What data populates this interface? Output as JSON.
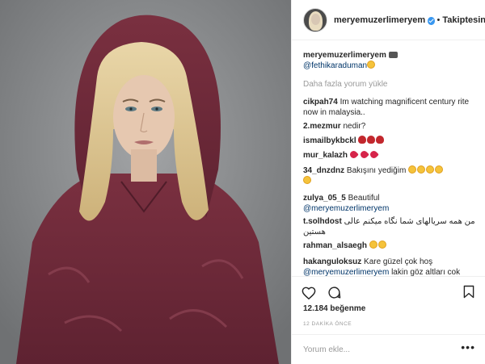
{
  "photo": {
    "alt_icon": "portrait-photo"
  },
  "header": {
    "username": "meryemuzerlimeryem",
    "separator": "•",
    "follow_state": "Takiptesin"
  },
  "caption": {
    "username": "meryemuzerlimeryem",
    "mention": "@fethikaraduman"
  },
  "load_more": "Daha fazla yorum yükle",
  "comments": [
    {
      "user": "cikpah74",
      "text": "Im watching magnificent century rite now in malaysia.."
    },
    {
      "user": "2.mezmur",
      "text": "nedir?"
    },
    {
      "user": "ismailbykbckl",
      "text": ""
    },
    {
      "user": "mur_kalazh",
      "text": ""
    },
    {
      "user": "34_dnzdnz",
      "text": "Bakışını yediğim"
    },
    {
      "user": "zulya_05_5",
      "text": "Beautiful",
      "mention": "@meryemuzerlimeryem"
    },
    {
      "user": "t.solhdost",
      "text": "من همه سریالهای شما نگاه میکنم عالی هستین"
    },
    {
      "user": "rahman_alsaegh",
      "text": ""
    },
    {
      "user": "hakanguloksuz",
      "text": "Kare güzel çok hoş",
      "mention": "@meryemuzerlimeryem",
      "text2": "lakin göz altları cok"
    }
  ],
  "likes": "12.184 beğenme",
  "time": "12 DAKİKA ÖNCE",
  "add_comment_placeholder": "Yorum ekle...",
  "options": "•••",
  "colors": {
    "verified": "#3897f0",
    "link": "#003569",
    "muted": "#999999"
  }
}
